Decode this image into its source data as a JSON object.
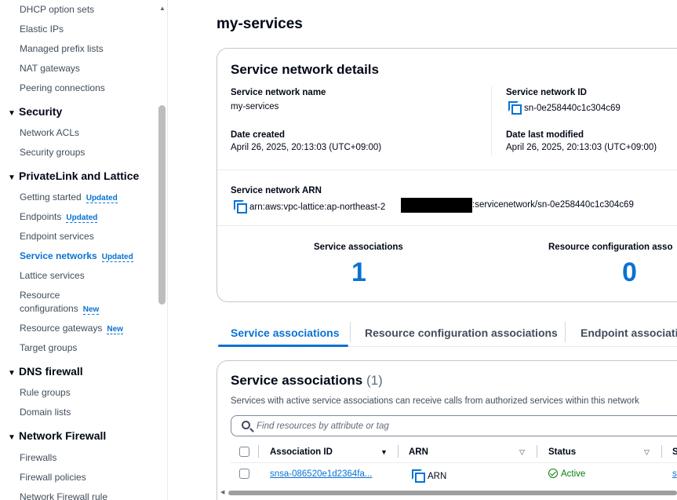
{
  "sidebar": {
    "items_top": [
      "DHCP option sets",
      "Elastic IPs",
      "Managed prefix lists",
      "NAT gateways",
      "Peering connections"
    ],
    "security": {
      "title": "Security",
      "items": [
        "Network ACLs",
        "Security groups"
      ]
    },
    "privatelink": {
      "title": "PrivateLink and Lattice",
      "getting_started": "Getting started",
      "endpoints": "Endpoints",
      "endpoint_services": "Endpoint services",
      "service_networks": "Service networks",
      "lattice_services": "Lattice services",
      "resource_line1": "Resource",
      "resource_line2": "configurations",
      "resource_gateways": "Resource gateways",
      "target_groups": "Target groups"
    },
    "badges": {
      "updated": "Updated",
      "new": "New"
    },
    "dns_firewall": {
      "title": "DNS firewall",
      "items": [
        "Rule groups",
        "Domain lists"
      ]
    },
    "network_firewall": {
      "title": "Network Firewall",
      "items": [
        "Firewalls",
        "Firewall policies",
        "Network Firewall rule"
      ]
    }
  },
  "page": {
    "title": "my-services"
  },
  "details": {
    "heading": "Service network details",
    "name_label": "Service network name",
    "name_value": "my-services",
    "id_label": "Service network ID",
    "id_value": "sn-0e258440c1c304c69",
    "created_label": "Date created",
    "created_value": "April 26, 2025, 20:13:03 (UTC+09:00)",
    "modified_label": "Date last modified",
    "modified_value": "April 26, 2025, 20:13:03 (UTC+09:00)",
    "arn_label": "Service network ARN",
    "arn_prefix": "arn:aws:vpc-lattice:ap-northeast-2",
    "arn_suffix": ":servicenetwork/sn-0e258440c1c304c69",
    "svc_assoc_label": "Service associations",
    "svc_assoc_count": "1",
    "res_assoc_label": "Resource configuration asso",
    "res_assoc_count": "0"
  },
  "tabs": [
    "Service associations",
    "Resource configuration associations",
    "Endpoint associati"
  ],
  "associations": {
    "heading": "Service associations",
    "count": "(1)",
    "description": "Services with active service associations can receive calls from authorized services within this network",
    "search_placeholder": "Find resources by attribute or tag",
    "columns": [
      "Association ID",
      "ARN",
      "Status",
      "S"
    ],
    "rows": [
      {
        "association_id": "snsa-086520e1d2364fa...",
        "arn": "ARN",
        "status": "Active",
        "extra": "s"
      }
    ]
  }
}
